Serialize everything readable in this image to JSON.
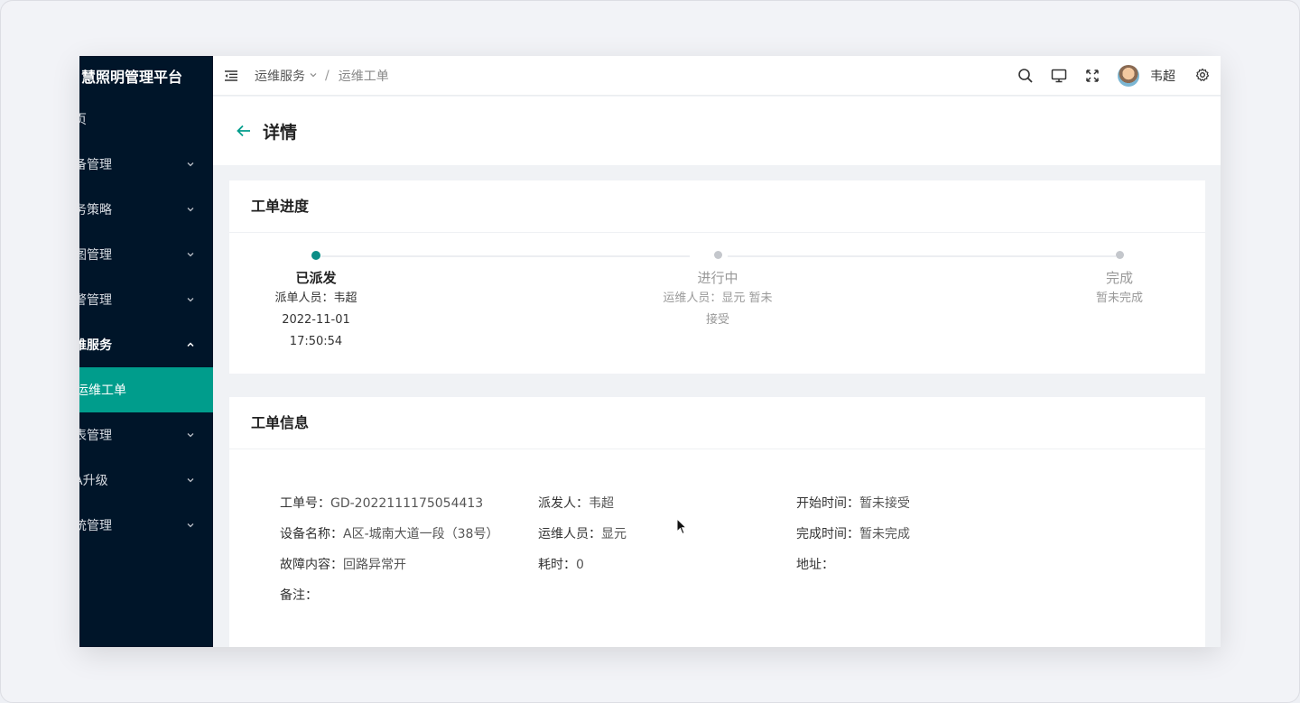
{
  "app": {
    "title": "慧照明管理平台"
  },
  "sidebar": {
    "items": [
      {
        "label": "页",
        "has_arrow": false
      },
      {
        "label": "备管理",
        "has_arrow": true
      },
      {
        "label": "务策略",
        "has_arrow": true
      },
      {
        "label": "图管理",
        "has_arrow": true
      },
      {
        "label": "警管理",
        "has_arrow": true
      },
      {
        "label": "维服务",
        "has_arrow": true,
        "expanded": true
      },
      {
        "label": "运维工单",
        "active": true
      },
      {
        "label": "表管理",
        "has_arrow": true
      },
      {
        "label": "A升级",
        "has_arrow": true
      },
      {
        "label": "统管理",
        "has_arrow": true
      }
    ]
  },
  "header": {
    "breadcrumb": [
      "运维服务",
      "/",
      "运维工单"
    ],
    "username": "韦超",
    "icons": [
      "menu-fold-icon",
      "search-icon",
      "monitor-icon",
      "fullscreen-icon",
      "avatar",
      "gear-icon"
    ]
  },
  "page": {
    "title": "详情"
  },
  "progress": {
    "title": "工单进度",
    "steps": [
      {
        "title": "已派发",
        "desc": [
          "派单人员：韦超",
          "2022-11-01",
          "17:50:54"
        ],
        "status": "done"
      },
      {
        "title": "进行中",
        "desc": [
          "运维人员：显元 暂未",
          "接受"
        ],
        "status": "wait"
      },
      {
        "title": "完成",
        "desc": [
          "暂未完成"
        ],
        "status": "wait"
      }
    ]
  },
  "info": {
    "title": "工单信息",
    "rows": [
      [
        {
          "k": "工单号：",
          "v": "GD-2022111175054413"
        },
        {
          "k": "派发人：",
          "v": "韦超"
        },
        {
          "k": "开始时间：",
          "v": "暂未接受"
        }
      ],
      [
        {
          "k": "设备名称：",
          "v": "A区-城南大道一段（38号）"
        },
        {
          "k": "运维人员：",
          "v": "显元"
        },
        {
          "k": "完成时间：",
          "v": "暂未完成"
        }
      ],
      [
        {
          "k": "故障内容：",
          "v": "回路异常开"
        },
        {
          "k": "耗时：",
          "v": "0"
        },
        {
          "k": "地址：",
          "v": ""
        }
      ],
      [
        {
          "k": "备注：",
          "v": ""
        }
      ]
    ]
  },
  "colors": {
    "accent": "#009d8c",
    "sidebar_bg": "#001529"
  }
}
